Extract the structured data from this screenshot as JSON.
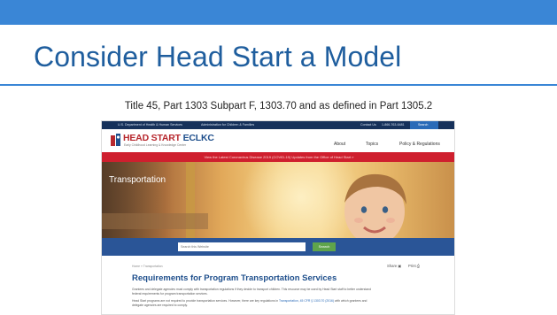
{
  "slide": {
    "title": "Consider Head Start a Model",
    "subtitle": "Title 45, Part 1303 Subpart F, 1303.70 and as defined in Part 1305.2",
    "colors": {
      "accent": "#3a86d6",
      "title": "#1f5e9e"
    }
  },
  "site": {
    "top_bar": {
      "hhs": "U.S. Department of Health & Human Services",
      "acf": "Administration for Children & Families",
      "contact": "Contact Us",
      "phone": "1-866-763-6481",
      "search": "Search"
    },
    "logo": {
      "head_start": "HEAD START",
      "eclkc": "ECLKC",
      "tagline": "Early Childhood Learning & Knowledge Center"
    },
    "nav": [
      "About",
      "Topics",
      "Policy & Regulations"
    ],
    "alert": "View the Latest Coronavirus Disease 2019 (COVID-19) Updates from the Office of Head Start »",
    "hero_label": "Transportation",
    "search": {
      "placeholder": "Search this Website",
      "button": "Search"
    },
    "breadcrumb": "Home » Transportation",
    "share": "Share",
    "print": "Print",
    "heading": "Requirements for Program Transportation Services",
    "para1_line1": "Grantees and delegate agencies must comply with transportation regulations if they decide to transport children. This resource may be used by Head Start staff to better understand",
    "para1_line2": "federal requirements for program transportation services.",
    "para2_line1_pre": "Head Start programs are not required to provide transportation services. However, there are key regulations in ",
    "para2_link": "Transportation, 45 CFR § 1303.70 (2016)",
    "para2_line1_post": " with which grantees and",
    "para2_line2": "delegate agencies are required to comply."
  }
}
